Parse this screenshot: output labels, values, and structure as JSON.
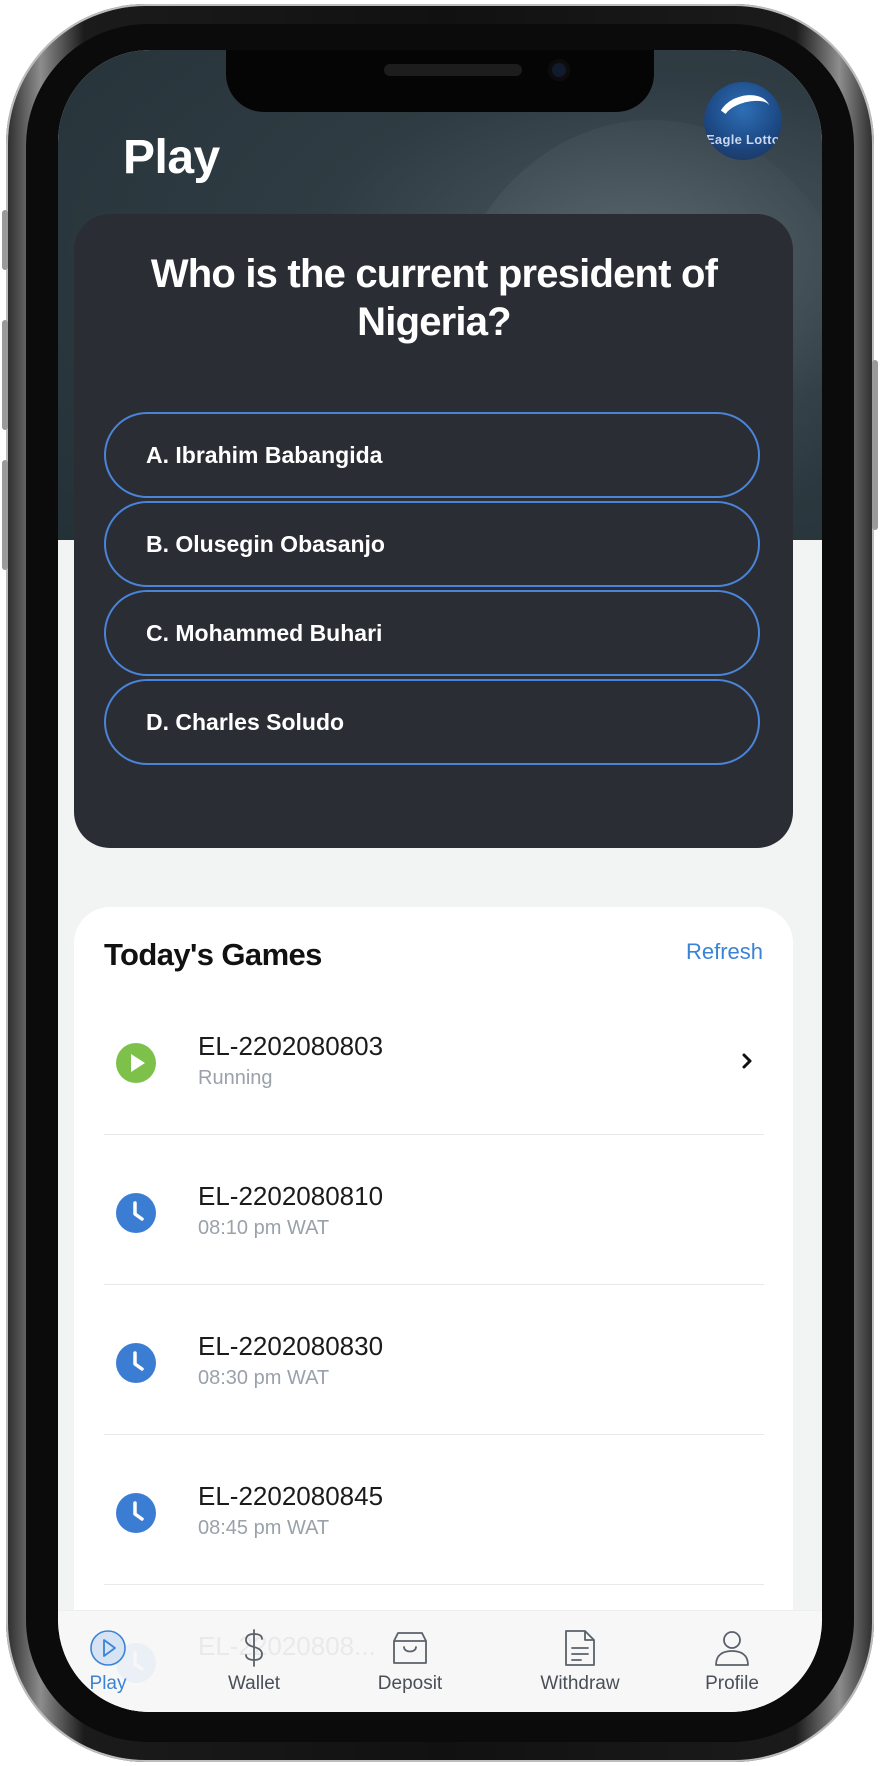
{
  "header": {
    "title": "Play",
    "logo_text": "Eagle Lotto"
  },
  "quiz": {
    "question": "Who is the current president of Nigeria?",
    "options": [
      {
        "label": "A. Ibrahim Babangida"
      },
      {
        "label": "B. Olusegin Obasanjo"
      },
      {
        "label": "C. Mohammed Buhari"
      },
      {
        "label": "D. Charles Soludo"
      }
    ]
  },
  "games": {
    "title": "Today's Games",
    "refresh_label": "Refresh",
    "items": [
      {
        "id": "EL-2202080803",
        "sub": "Running",
        "icon": "play-circle-icon"
      },
      {
        "id": "EL-2202080810",
        "sub": "08:10 pm WAT",
        "icon": "clock-icon"
      },
      {
        "id": "EL-2202080830",
        "sub": "08:30 pm WAT",
        "icon": "clock-icon"
      },
      {
        "id": "EL-2202080845",
        "sub": "08:45 pm WAT",
        "icon": "clock-icon"
      },
      {
        "id": "EL-22020808...",
        "sub": "",
        "icon": "clock-icon"
      }
    ]
  },
  "nav": {
    "items": [
      {
        "label": "Play",
        "icon": "play-circle-icon",
        "active": true
      },
      {
        "label": "Wallet",
        "icon": "dollar-icon",
        "active": false
      },
      {
        "label": "Deposit",
        "icon": "shopping-bag-icon",
        "active": false
      },
      {
        "label": "Withdraw",
        "icon": "document-icon",
        "active": false
      },
      {
        "label": "Profile",
        "icon": "user-icon",
        "active": false
      }
    ]
  },
  "colors": {
    "accent": "#3b83d4",
    "running": "#7dc04a",
    "card_dark": "#2a2d34",
    "option_border": "#4a84d8"
  }
}
